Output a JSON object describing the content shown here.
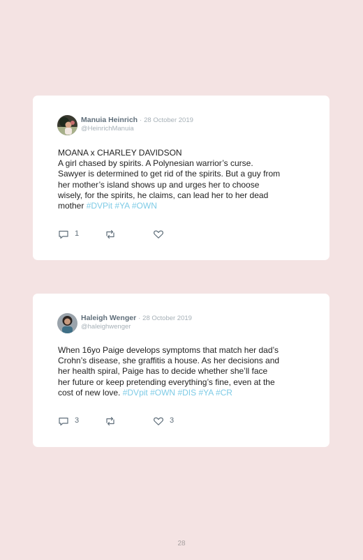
{
  "tweets": [
    {
      "author": "Manuia Heinrich",
      "separator": "·",
      "date": "28 October 2019",
      "handle": "@HeinrichManuia",
      "text_lines": [
        "MOANA x CHARLEY DAVIDSON",
        "A girl chased by spirits. A Polynesian warrior’s curse.",
        "Sawyer is determined to get rid of the spirits. But a guy from",
        "her mother’s island shows up and urges her to choose",
        "wisely, for the spirits, he claims, can lead her to her dead"
      ],
      "last_line_text": "mother ",
      "hashtags": [
        "#DVPit",
        "#YA",
        "#OWN"
      ],
      "reply_count": "1",
      "retweet_count": "",
      "like_count": ""
    },
    {
      "author": "Haleigh Wenger",
      "separator": "·",
      "date": "28 October 2019",
      "handle": "@haleighwenger",
      "text_lines": [
        "When 16yo Paige develops symptoms that match her dad’s",
        "Crohn’s disease, she graffitis a house. As her decisions and",
        "her health spiral, Paige has to decide whether she’ll face",
        "her future or keep pretending everything’s fine, even at the"
      ],
      "last_line_text": "cost of new love. ",
      "hashtags": [
        "#DVpit",
        "#OWN",
        "#DIS",
        "#YA",
        "#CR"
      ],
      "reply_count": "3",
      "retweet_count": "",
      "like_count": "3"
    }
  ],
  "icons": {
    "reply": "reply-icon",
    "retweet": "retweet-icon",
    "like": "heart-icon"
  },
  "colors": {
    "background": "#f4e3e3",
    "card": "#ffffff",
    "hashtag": "#7ecbe6",
    "author": "#5f6e7a",
    "muted": "#a6b0b7"
  },
  "page_number": "28"
}
